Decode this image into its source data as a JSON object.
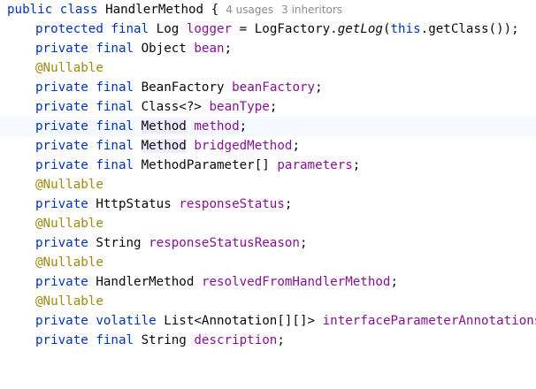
{
  "class_decl": {
    "kw_public": "public",
    "kw_class": "class",
    "name": "HandlerMethod",
    "brace": "{",
    "usages_hint": "4 usages",
    "inheritors_hint": "3 inheritors"
  },
  "lines": {
    "l1": {
      "kw": "protected final",
      "type": "Log",
      "field": "logger",
      "eq": "=",
      "cls": "LogFactory.",
      "method": "getLog",
      "open": "(",
      "this": "this",
      "rest": ".getClass());"
    },
    "l2": {
      "kw": "private final",
      "type": "Object",
      "field": "bean",
      "end": ";"
    },
    "l3": {
      "ann": "@Nullable"
    },
    "l4": {
      "kw": "private final",
      "type": "BeanFactory",
      "field": "beanFactory",
      "end": ";"
    },
    "l5": {
      "kw": "private final",
      "type": "Class<?>",
      "field": "beanType",
      "end": ";"
    },
    "l6": {
      "kw": "private final",
      "type": "Method",
      "field": "method",
      "end": ";"
    },
    "l7": {
      "kw": "private final",
      "type": "Method",
      "field": "bridgedMethod",
      "end": ";"
    },
    "l8": {
      "kw": "private final",
      "type": "MethodParameter[]",
      "field": "parameters",
      "end": ";"
    },
    "l9": {
      "ann": "@Nullable"
    },
    "l10": {
      "kw": "private",
      "type": "HttpStatus",
      "field": "responseStatus",
      "end": ";"
    },
    "l11": {
      "ann": "@Nullable"
    },
    "l12": {
      "kw": "private",
      "type": "String",
      "field": "responseStatusReason",
      "end": ";"
    },
    "l13": {
      "ann": "@Nullable"
    },
    "l14": {
      "kw": "private",
      "type": "HandlerMethod",
      "field": "resolvedFromHandlerMethod",
      "end": ";"
    },
    "l15": {
      "ann": "@Nullable"
    },
    "l16": {
      "kw": "private volatile",
      "type": "List<Annotation[][]>",
      "field": "interfaceParameterAnnotations",
      "end": ";"
    },
    "l17": {
      "kw": "private final",
      "type": "String",
      "field": "description",
      "end": ";"
    }
  },
  "colors": {
    "keyword": "#0033b3",
    "field": "#871094",
    "annotation": "#9e880d",
    "hint": "#8c8c8c",
    "current_line": "#f5f8fe",
    "usage_highlight": "#edebfc"
  }
}
